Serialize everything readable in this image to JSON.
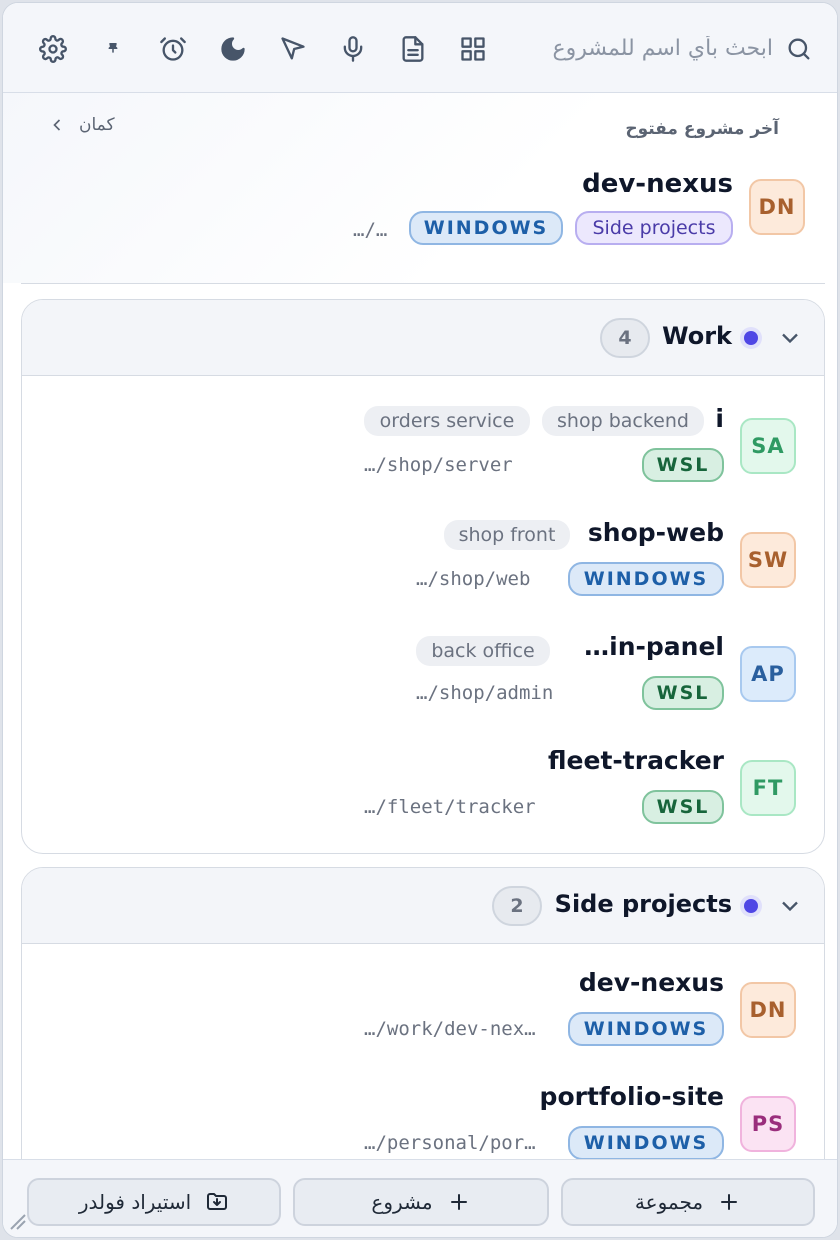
{
  "toolbar": {
    "search_placeholder": "ابحث بأي اسم للمشروع",
    "icons": [
      "search-icon",
      "grid-icon",
      "document-icon",
      "microphone-icon",
      "send-icon",
      "moon-icon",
      "alarm-icon",
      "pin-icon",
      "gear-icon"
    ]
  },
  "recent": {
    "label": "آخر مشروع مفتوح",
    "more_label": "كمان",
    "project": {
      "initials": "DN",
      "name": "dev-nexus",
      "group_badge": "Side projects",
      "os": "WINDOWS",
      "path": "…/…"
    }
  },
  "groups": [
    {
      "name": "Work",
      "count": "4",
      "accent": "#4f46e5",
      "projects": [
        {
          "initials": "SA",
          "name": "i",
          "os": "WSL",
          "path": "…/shop/server",
          "tags": [
            "shop backend",
            "orders service"
          ]
        },
        {
          "initials": "SW",
          "name": "shop-web",
          "os": "WINDOWS",
          "path": "…/shop/web",
          "tags": [
            "shop front"
          ]
        },
        {
          "initials": "AP",
          "name": "…in-panel",
          "os": "WSL",
          "path": "…/shop/admin",
          "tags": [
            "back office"
          ]
        },
        {
          "initials": "FT",
          "name": "fleet-tracker",
          "os": "WSL",
          "path": "…/fleet/tracker",
          "tags": []
        }
      ]
    },
    {
      "name": "Side projects",
      "count": "2",
      "accent": "#4f46e5",
      "projects": [
        {
          "initials": "DN",
          "name": "dev-nexus",
          "os": "WINDOWS",
          "path": "…/work/dev-nex…",
          "tags": []
        },
        {
          "initials": "PS",
          "name": "portfolio-site",
          "os": "WINDOWS",
          "path": "…/personal/por…",
          "tags": []
        }
      ]
    }
  ],
  "footer": {
    "new_group": "مجموعة",
    "new_project": "مشروع",
    "import_folder": "استيراد فولدر"
  }
}
